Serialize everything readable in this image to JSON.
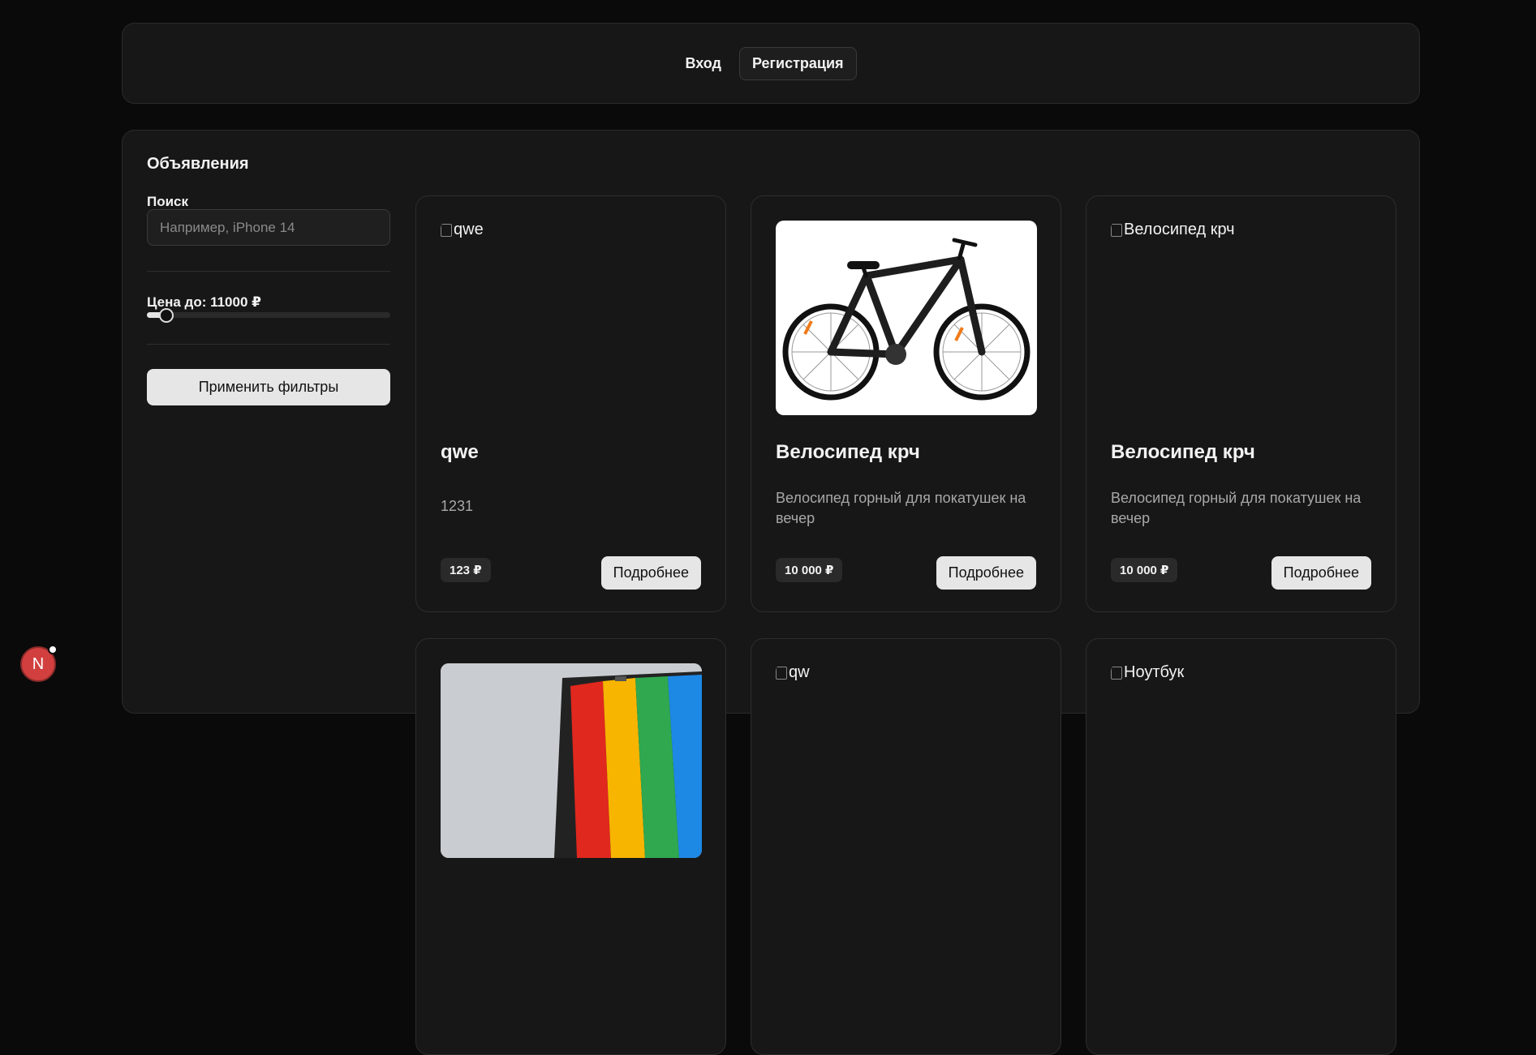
{
  "header": {
    "login": "Вход",
    "register": "Регистрация"
  },
  "section_title": "Объявления",
  "filters": {
    "search_label": "Поиск",
    "search_placeholder": "Например, iPhone 14",
    "price_label": "Цена до: 11000 ₽",
    "price_value": 11000,
    "price_slider_fraction": 0.08,
    "apply_label": "Применить фильтры"
  },
  "cards": [
    {
      "image_alt": "qwe",
      "image_loaded": false,
      "title": "qwe",
      "description": "1231",
      "price": "123 ₽",
      "button": "Подробнее"
    },
    {
      "image_alt": "",
      "image_loaded": true,
      "title": "Велосипед крч",
      "description": "Велосипед горный для покатушек на вечер",
      "price": "10 000 ₽",
      "button": "Подробнее"
    },
    {
      "image_alt": "Велосипед крч",
      "image_loaded": false,
      "title": "Велосипед крч",
      "description": "Велосипед горный для покатушек на вечер",
      "price": "10 000 ₽",
      "button": "Подробнее"
    },
    {
      "image_alt": "",
      "image_loaded": true
    },
    {
      "image_alt": "qw",
      "image_loaded": false
    },
    {
      "image_alt": "Ноутбук",
      "image_loaded": false
    }
  ],
  "dev_badge": "N"
}
